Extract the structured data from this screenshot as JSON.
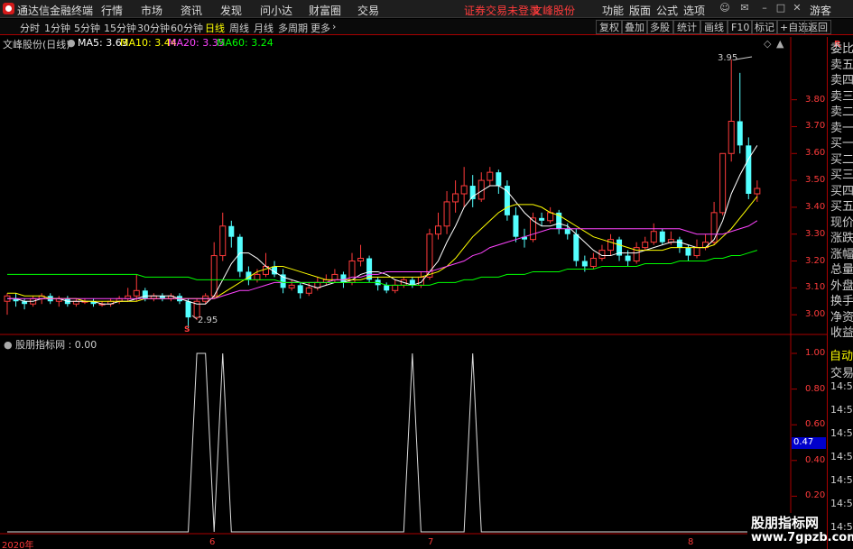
{
  "titlebar": {
    "app_title": "通达信金融终端",
    "menu": [
      "行情",
      "市场",
      "资讯",
      "发现",
      "问小达",
      "财富圈",
      "交易"
    ],
    "warning": "证券交易未登录",
    "stock_name": "文峰股份",
    "right_menu": [
      "功能",
      "版面",
      "公式",
      "选项"
    ],
    "user": "游客"
  },
  "toolbar": {
    "periods": [
      "分时",
      "1分钟",
      "5分钟",
      "15分钟",
      "30分钟",
      "60分钟",
      "日线",
      "周线",
      "月线",
      "多周期",
      "更多"
    ],
    "active_period": "日线",
    "right_buttons": [
      "复权",
      "叠加",
      "多股",
      "统计",
      "画线",
      "F10",
      "标记",
      "+自选",
      "返回"
    ]
  },
  "chart_header": {
    "title": "文峰股份(日线)",
    "ma5": "MA5: 3.63",
    "ma10": "MA10: 3.44",
    "ma20": "MA20: 3.35",
    "ma60": "MA60: 3.24",
    "colors": {
      "ma5": "#ffffff",
      "ma10": "#ffff00",
      "ma20": "#ff44ff",
      "ma60": "#00ff00"
    }
  },
  "side_panel": {
    "items": [
      "委比",
      "卖五",
      "卖四",
      "卖三",
      "卖二",
      "卖一",
      "买一",
      "买二",
      "买三",
      "买四",
      "买五",
      "现价",
      "涨跌",
      "涨幅",
      "总量",
      "外盘",
      "换手",
      "净资",
      "收益"
    ],
    "top_label": "R",
    "auto": "自动",
    "trade": "交易",
    "times": [
      "14:56",
      "14:56",
      "14:56",
      "14:56",
      "14:56",
      "14:56",
      "14:56"
    ]
  },
  "indicator": {
    "header": "股朋指标网 : 0.00",
    "current_value": "0.47"
  },
  "watermark": {
    "line1": "股朋指标网",
    "line2": "www.7gpzb.com"
  },
  "annotations": {
    "high_label": "3.95",
    "low_label": "2.95",
    "s_marker": "S"
  },
  "x_axis": {
    "labels": [
      "2020年",
      "6",
      "7",
      "8"
    ]
  },
  "chart_data": [
    {
      "type": "candlestick",
      "title": "文峰股份(日线)",
      "y_ticks": [
        3.0,
        3.1,
        3.2,
        3.3,
        3.4,
        3.5,
        3.6,
        3.7,
        3.8
      ],
      "ylim": [
        2.93,
        3.98
      ],
      "up_color": "#ff3b3b",
      "down_color": "#54ffff",
      "candles": [
        [
          3.05,
          3.07,
          3.0,
          3.08
        ],
        [
          3.06,
          3.05,
          3.03,
          3.08
        ],
        [
          3.05,
          3.04,
          3.02,
          3.06
        ],
        [
          3.04,
          3.06,
          3.03,
          3.07
        ],
        [
          3.06,
          3.07,
          3.04,
          3.08
        ],
        [
          3.07,
          3.05,
          3.04,
          3.08
        ],
        [
          3.05,
          3.06,
          3.03,
          3.07
        ],
        [
          3.06,
          3.04,
          3.03,
          3.07
        ],
        [
          3.04,
          3.05,
          3.03,
          3.06
        ],
        [
          3.05,
          3.05,
          3.04,
          3.06
        ],
        [
          3.05,
          3.04,
          3.03,
          3.06
        ],
        [
          3.04,
          3.04,
          3.03,
          3.05
        ],
        [
          3.04,
          3.05,
          3.03,
          3.06
        ],
        [
          3.05,
          3.06,
          3.04,
          3.07
        ],
        [
          3.06,
          3.07,
          3.05,
          3.1
        ],
        [
          3.07,
          3.09,
          3.05,
          3.15
        ],
        [
          3.09,
          3.06,
          3.05,
          3.1
        ],
        [
          3.06,
          3.07,
          3.05,
          3.08
        ],
        [
          3.07,
          3.06,
          3.05,
          3.08
        ],
        [
          3.06,
          3.07,
          3.05,
          3.08
        ],
        [
          3.07,
          3.05,
          3.04,
          3.08
        ],
        [
          3.05,
          2.99,
          2.95,
          3.06
        ],
        [
          2.99,
          3.05,
          2.98,
          3.06
        ],
        [
          3.05,
          3.07,
          3.04,
          3.08
        ],
        [
          3.07,
          3.22,
          3.06,
          3.27
        ],
        [
          3.22,
          3.33,
          3.2,
          3.38
        ],
        [
          3.33,
          3.29,
          3.25,
          3.35
        ],
        [
          3.29,
          3.16,
          3.14,
          3.3
        ],
        [
          3.16,
          3.13,
          3.11,
          3.18
        ],
        [
          3.13,
          3.15,
          3.12,
          3.17
        ],
        [
          3.15,
          3.18,
          3.14,
          3.23
        ],
        [
          3.18,
          3.15,
          3.14,
          3.2
        ],
        [
          3.15,
          3.1,
          3.08,
          3.17
        ],
        [
          3.1,
          3.11,
          3.09,
          3.13
        ],
        [
          3.11,
          3.08,
          3.06,
          3.12
        ],
        [
          3.08,
          3.1,
          3.07,
          3.12
        ],
        [
          3.1,
          3.12,
          3.09,
          3.14
        ],
        [
          3.12,
          3.13,
          3.11,
          3.15
        ],
        [
          3.13,
          3.15,
          3.12,
          3.17
        ],
        [
          3.15,
          3.12,
          3.1,
          3.16
        ],
        [
          3.12,
          3.2,
          3.11,
          3.23
        ],
        [
          3.2,
          3.21,
          3.18,
          3.26
        ],
        [
          3.21,
          3.13,
          3.12,
          3.22
        ],
        [
          3.13,
          3.11,
          3.09,
          3.14
        ],
        [
          3.11,
          3.09,
          3.08,
          3.12
        ],
        [
          3.09,
          3.11,
          3.08,
          3.13
        ],
        [
          3.11,
          3.13,
          3.1,
          3.14
        ],
        [
          3.13,
          3.11,
          3.1,
          3.14
        ],
        [
          3.11,
          3.14,
          3.1,
          3.16
        ],
        [
          3.14,
          3.3,
          3.13,
          3.32
        ],
        [
          3.3,
          3.33,
          3.28,
          3.38
        ],
        [
          3.33,
          3.42,
          3.3,
          3.46
        ],
        [
          3.42,
          3.45,
          3.38,
          3.5
        ],
        [
          3.45,
          3.48,
          3.4,
          3.55
        ],
        [
          3.48,
          3.43,
          3.4,
          3.52
        ],
        [
          3.43,
          3.5,
          3.42,
          3.53
        ],
        [
          3.5,
          3.53,
          3.48,
          3.55
        ],
        [
          3.53,
          3.48,
          3.45,
          3.54
        ],
        [
          3.48,
          3.37,
          3.35,
          3.5
        ],
        [
          3.37,
          3.29,
          3.27,
          3.4
        ],
        [
          3.29,
          3.28,
          3.25,
          3.32
        ],
        [
          3.28,
          3.36,
          3.27,
          3.38
        ],
        [
          3.36,
          3.35,
          3.33,
          3.38
        ],
        [
          3.35,
          3.38,
          3.34,
          3.4
        ],
        [
          3.38,
          3.32,
          3.3,
          3.39
        ],
        [
          3.32,
          3.3,
          3.28,
          3.34
        ],
        [
          3.3,
          3.2,
          3.18,
          3.32
        ],
        [
          3.2,
          3.18,
          3.16,
          3.22
        ],
        [
          3.18,
          3.21,
          3.17,
          3.23
        ],
        [
          3.21,
          3.24,
          3.2,
          3.26
        ],
        [
          3.24,
          3.28,
          3.22,
          3.3
        ],
        [
          3.28,
          3.22,
          3.2,
          3.29
        ],
        [
          3.22,
          3.2,
          3.18,
          3.24
        ],
        [
          3.2,
          3.25,
          3.19,
          3.27
        ],
        [
          3.25,
          3.27,
          3.24,
          3.29
        ],
        [
          3.27,
          3.31,
          3.26,
          3.34
        ],
        [
          3.31,
          3.27,
          3.26,
          3.32
        ],
        [
          3.27,
          3.28,
          3.26,
          3.31
        ],
        [
          3.28,
          3.25,
          3.23,
          3.29
        ],
        [
          3.25,
          3.22,
          3.2,
          3.26
        ],
        [
          3.22,
          3.25,
          3.21,
          3.28
        ],
        [
          3.25,
          3.27,
          3.24,
          3.3
        ],
        [
          3.27,
          3.38,
          3.26,
          3.42
        ],
        [
          3.38,
          3.6,
          3.37,
          3.6
        ],
        [
          3.6,
          3.72,
          3.57,
          3.95
        ],
        [
          3.72,
          3.63,
          3.6,
          3.9
        ],
        [
          3.63,
          3.45,
          3.43,
          3.66
        ],
        [
          3.45,
          3.47,
          3.42,
          3.5
        ]
      ],
      "ma_lines": {
        "MA5": [
          3.06,
          3.06,
          3.05,
          3.05,
          3.06,
          3.06,
          3.06,
          3.05,
          3.05,
          3.05,
          3.05,
          3.04,
          3.04,
          3.05,
          3.05,
          3.06,
          3.07,
          3.07,
          3.07,
          3.07,
          3.06,
          3.05,
          3.04,
          3.04,
          3.07,
          3.13,
          3.19,
          3.23,
          3.23,
          3.21,
          3.18,
          3.16,
          3.14,
          3.13,
          3.12,
          3.11,
          3.1,
          3.11,
          3.12,
          3.12,
          3.13,
          3.15,
          3.16,
          3.16,
          3.15,
          3.13,
          3.12,
          3.11,
          3.12,
          3.16,
          3.2,
          3.27,
          3.33,
          3.4,
          3.44,
          3.46,
          3.48,
          3.48,
          3.46,
          3.42,
          3.38,
          3.35,
          3.33,
          3.33,
          3.34,
          3.33,
          3.3,
          3.27,
          3.24,
          3.22,
          3.22,
          3.23,
          3.23,
          3.23,
          3.24,
          3.25,
          3.26,
          3.27,
          3.27,
          3.26,
          3.25,
          3.25,
          3.28,
          3.35,
          3.45,
          3.52,
          3.58,
          3.63
        ],
        "MA10": [
          3.08,
          3.08,
          3.07,
          3.07,
          3.07,
          3.06,
          3.06,
          3.06,
          3.06,
          3.05,
          3.05,
          3.05,
          3.05,
          3.05,
          3.05,
          3.05,
          3.06,
          3.06,
          3.06,
          3.06,
          3.06,
          3.06,
          3.06,
          3.06,
          3.06,
          3.08,
          3.1,
          3.12,
          3.14,
          3.16,
          3.17,
          3.18,
          3.18,
          3.17,
          3.16,
          3.15,
          3.14,
          3.13,
          3.13,
          3.13,
          3.13,
          3.13,
          3.14,
          3.14,
          3.14,
          3.14,
          3.14,
          3.14,
          3.14,
          3.15,
          3.16,
          3.18,
          3.21,
          3.25,
          3.29,
          3.32,
          3.35,
          3.38,
          3.4,
          3.41,
          3.41,
          3.41,
          3.4,
          3.38,
          3.37,
          3.35,
          3.33,
          3.31,
          3.29,
          3.28,
          3.27,
          3.26,
          3.25,
          3.24,
          3.24,
          3.24,
          3.24,
          3.25,
          3.25,
          3.25,
          3.25,
          3.25,
          3.26,
          3.29,
          3.32,
          3.36,
          3.4,
          3.44
        ],
        "MA20": [
          3.06,
          3.06,
          3.06,
          3.06,
          3.06,
          3.06,
          3.06,
          3.06,
          3.06,
          3.06,
          3.06,
          3.06,
          3.06,
          3.06,
          3.06,
          3.06,
          3.06,
          3.06,
          3.06,
          3.06,
          3.06,
          3.06,
          3.06,
          3.06,
          3.06,
          3.07,
          3.08,
          3.09,
          3.09,
          3.1,
          3.11,
          3.12,
          3.12,
          3.12,
          3.12,
          3.12,
          3.12,
          3.12,
          3.13,
          3.13,
          3.14,
          3.14,
          3.15,
          3.15,
          3.16,
          3.16,
          3.16,
          3.16,
          3.16,
          3.16,
          3.17,
          3.18,
          3.19,
          3.2,
          3.22,
          3.23,
          3.25,
          3.26,
          3.27,
          3.28,
          3.29,
          3.3,
          3.31,
          3.32,
          3.32,
          3.32,
          3.32,
          3.32,
          3.32,
          3.32,
          3.32,
          3.32,
          3.32,
          3.32,
          3.32,
          3.32,
          3.32,
          3.32,
          3.32,
          3.31,
          3.3,
          3.3,
          3.3,
          3.3,
          3.31,
          3.32,
          3.33,
          3.35
        ],
        "MA60": [
          3.15,
          3.15,
          3.15,
          3.15,
          3.15,
          3.15,
          3.15,
          3.15,
          3.15,
          3.15,
          3.15,
          3.15,
          3.15,
          3.15,
          3.15,
          3.15,
          3.14,
          3.14,
          3.14,
          3.14,
          3.14,
          3.14,
          3.13,
          3.13,
          3.13,
          3.13,
          3.13,
          3.13,
          3.13,
          3.13,
          3.13,
          3.13,
          3.12,
          3.12,
          3.12,
          3.12,
          3.12,
          3.12,
          3.12,
          3.12,
          3.12,
          3.12,
          3.12,
          3.12,
          3.11,
          3.11,
          3.11,
          3.11,
          3.11,
          3.11,
          3.12,
          3.12,
          3.12,
          3.13,
          3.13,
          3.14,
          3.14,
          3.14,
          3.15,
          3.15,
          3.15,
          3.16,
          3.16,
          3.16,
          3.16,
          3.17,
          3.17,
          3.17,
          3.17,
          3.18,
          3.18,
          3.18,
          3.18,
          3.18,
          3.19,
          3.19,
          3.19,
          3.19,
          3.2,
          3.2,
          3.2,
          3.2,
          3.21,
          3.21,
          3.22,
          3.22,
          3.23,
          3.24
        ]
      }
    },
    {
      "type": "line",
      "title": "股朋指标网",
      "y_ticks": [
        0.2,
        0.4,
        0.6,
        0.8,
        1.0
      ],
      "ylim": [
        0.0,
        1.0
      ],
      "line_color": "#dddddd",
      "spikes": [
        {
          "start": 21,
          "top_from": 22,
          "top_to": 23,
          "end": 24
        },
        {
          "start": 24,
          "top_from": 25,
          "top_to": 25,
          "end": 26
        },
        {
          "start": 46,
          "top_from": 47,
          "top_to": 47,
          "end": 48
        },
        {
          "start": 53,
          "top_from": 54,
          "top_to": 54,
          "end": 55
        }
      ]
    }
  ]
}
